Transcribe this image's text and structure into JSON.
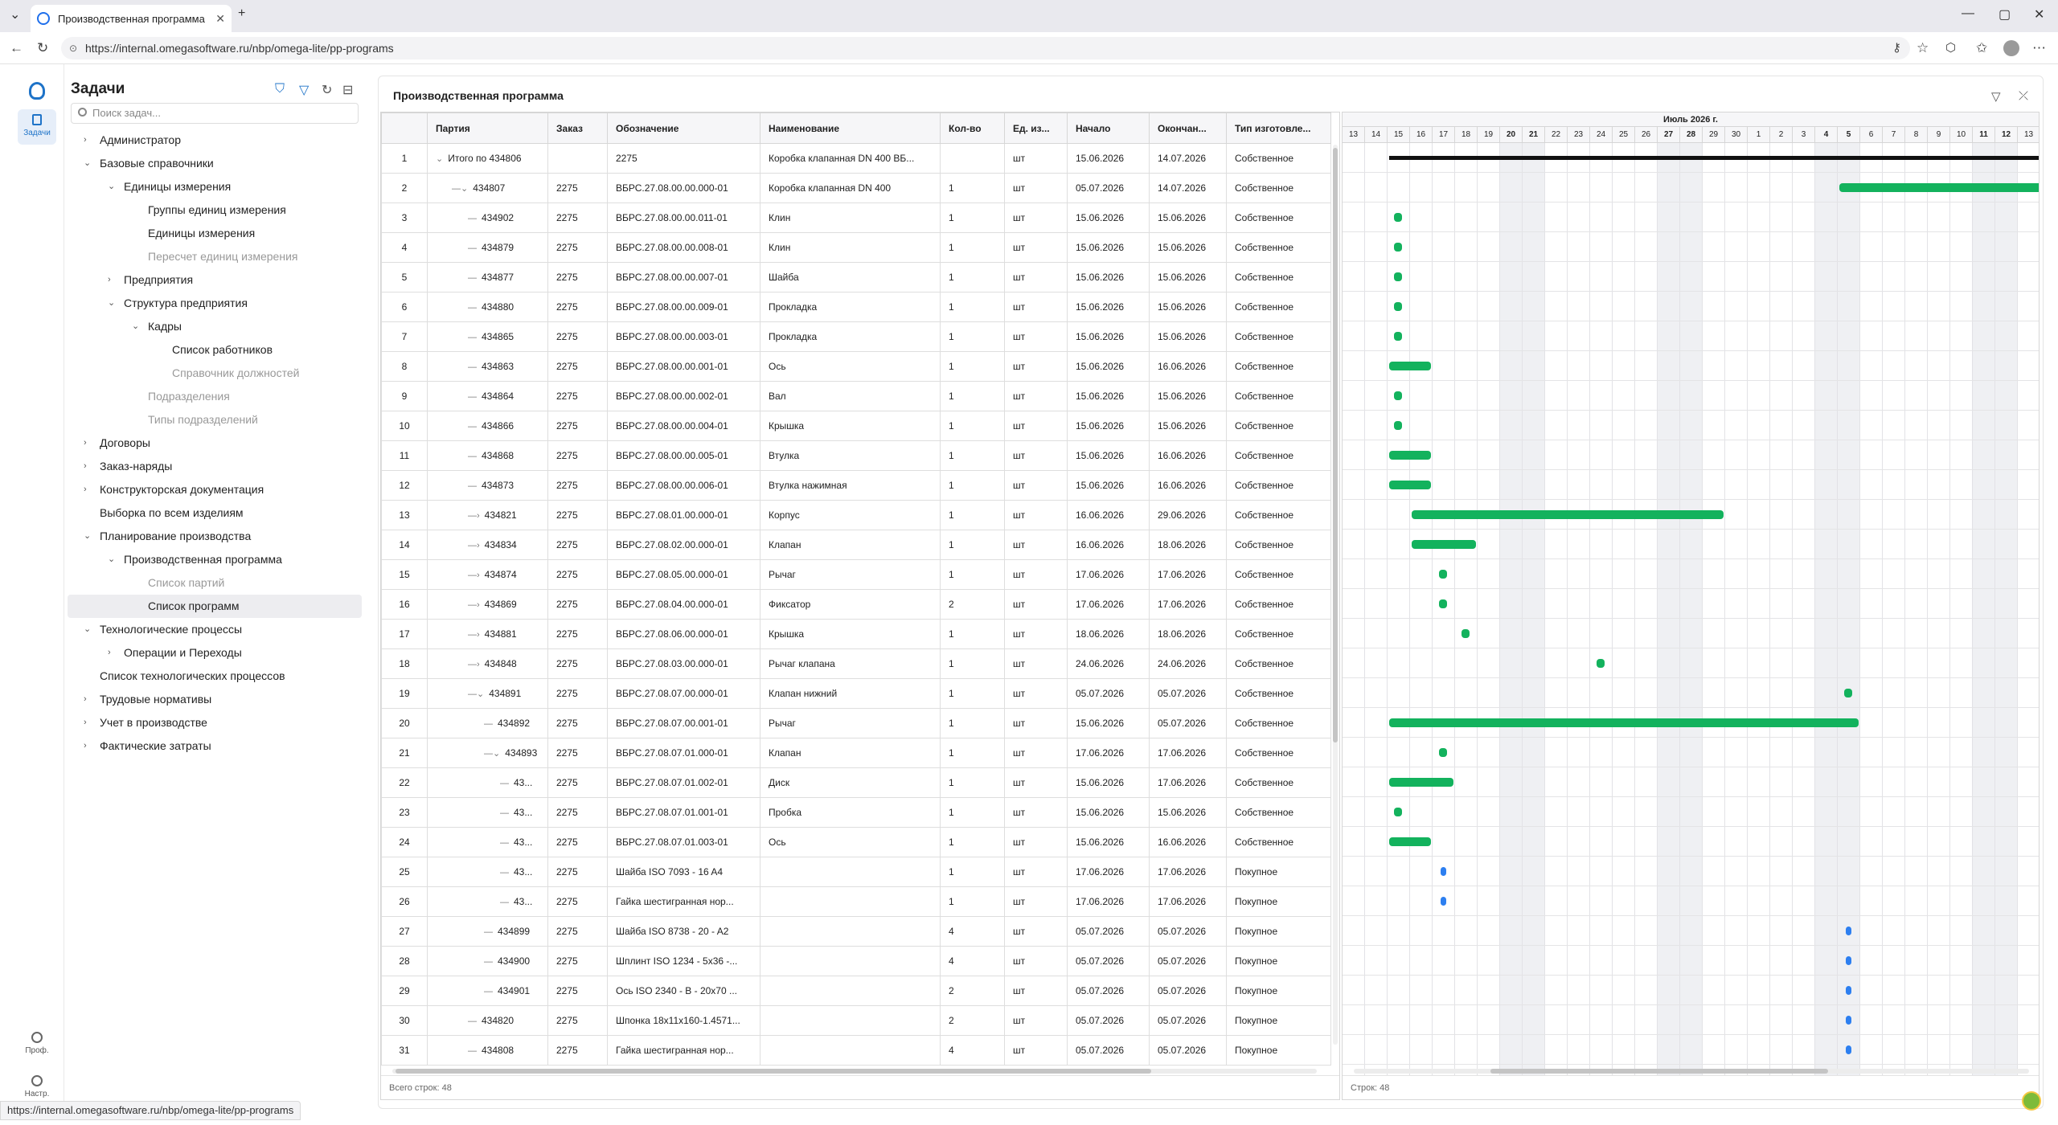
{
  "browser": {
    "tab_title": "Производственная программа",
    "url": "https://internal.omegasoftware.ru/nbp/omega-lite/pp-programs",
    "status_url": "https://internal.omegasoftware.ru/nbp/omega-lite/pp-programs"
  },
  "rail": {
    "tasks_label": "Задачи",
    "profile_label": "Проф.",
    "settings_label": "Настр."
  },
  "nav": {
    "title": "Задачи",
    "search_placeholder": "Поиск задач...",
    "items": [
      {
        "label": "Администратор",
        "level": 0,
        "chev": "›",
        "state": ""
      },
      {
        "label": "Базовые справочники",
        "level": 0,
        "chev": "⌄",
        "state": ""
      },
      {
        "label": "Единицы измерения",
        "level": 1,
        "chev": "⌄",
        "state": ""
      },
      {
        "label": "Группы единиц измерения",
        "level": 2,
        "chev": "",
        "state": ""
      },
      {
        "label": "Единицы измерения",
        "level": 2,
        "chev": "",
        "state": ""
      },
      {
        "label": "Пересчет единиц измерения",
        "level": 2,
        "chev": "",
        "state": "dis"
      },
      {
        "label": "Предприятия",
        "level": 1,
        "chev": "›",
        "state": ""
      },
      {
        "label": "Структура предприятия",
        "level": 1,
        "chev": "⌄",
        "state": ""
      },
      {
        "label": "Кадры",
        "level": 2,
        "chev": "⌄",
        "state": ""
      },
      {
        "label": "Список работников",
        "level": 3,
        "chev": "",
        "state": ""
      },
      {
        "label": "Справочник должностей",
        "level": 3,
        "chev": "",
        "state": "dis"
      },
      {
        "label": "Подразделения",
        "level": 2,
        "chev": "",
        "state": "dis"
      },
      {
        "label": "Типы подразделений",
        "level": 2,
        "chev": "",
        "state": "dis"
      },
      {
        "label": "Договоры",
        "level": 0,
        "chev": "›",
        "state": ""
      },
      {
        "label": "Заказ-наряды",
        "level": 0,
        "chev": "›",
        "state": ""
      },
      {
        "label": "Конструкторская документация",
        "level": 0,
        "chev": "›",
        "state": ""
      },
      {
        "label": "Выборка по всем изделиям",
        "level": 1,
        "chev": "",
        "state": "",
        "flat": true
      },
      {
        "label": "Планирование производства",
        "level": 0,
        "chev": "⌄",
        "state": ""
      },
      {
        "label": "Производственная программа",
        "level": 1,
        "chev": "⌄",
        "state": ""
      },
      {
        "label": "Список партий",
        "level": 2,
        "chev": "",
        "state": "dis"
      },
      {
        "label": "Список программ",
        "level": 2,
        "chev": "",
        "state": "sel"
      },
      {
        "label": "Технологические процессы",
        "level": 0,
        "chev": "⌄",
        "state": ""
      },
      {
        "label": "Операции и Переходы",
        "level": 1,
        "chev": "›",
        "state": ""
      },
      {
        "label": "Список технологических процессов",
        "level": 1,
        "chev": "",
        "state": "",
        "flat": true
      },
      {
        "label": "Трудовые нормативы",
        "level": 0,
        "chev": "›",
        "state": ""
      },
      {
        "label": "Учет в производстве",
        "level": 0,
        "chev": "›",
        "state": ""
      },
      {
        "label": "Фактические затраты",
        "level": 0,
        "chev": "›",
        "state": ""
      }
    ]
  },
  "main": {
    "title": "Производственная программа",
    "columns": [
      "",
      "Партия",
      "Заказ",
      "Обозначение",
      "Наименование",
      "Кол-во",
      "Ед. из...",
      "Начало",
      "Окончан...",
      "Тип изготовле..."
    ],
    "rows": [
      {
        "n": "1",
        "part": "Итого по 434806",
        "depth": 0,
        "exp": "⌄",
        "order": "",
        "code": "2275",
        "name": "Коробка клапанная DN 400 ВБ...",
        "qty": "",
        "unit": "шт",
        "start": "15.06.2026",
        "end": "14.07.2026",
        "type": "Собственное"
      },
      {
        "n": "2",
        "part": "434807",
        "depth": 1,
        "exp": "⌄",
        "order": "2275",
        "code": "ВБРС.27.08.00.00.000-01",
        "name": "Коробка клапанная DN 400",
        "qty": "1",
        "unit": "шт",
        "start": "05.07.2026",
        "end": "14.07.2026",
        "type": "Собственное"
      },
      {
        "n": "3",
        "part": "434902",
        "depth": 2,
        "exp": "",
        "order": "2275",
        "code": "ВБРС.27.08.00.00.011-01",
        "name": "Клин",
        "qty": "1",
        "unit": "шт",
        "start": "15.06.2026",
        "end": "15.06.2026",
        "type": "Собственное"
      },
      {
        "n": "4",
        "part": "434879",
        "depth": 2,
        "exp": "",
        "order": "2275",
        "code": "ВБРС.27.08.00.00.008-01",
        "name": "Клин",
        "qty": "1",
        "unit": "шт",
        "start": "15.06.2026",
        "end": "15.06.2026",
        "type": "Собственное"
      },
      {
        "n": "5",
        "part": "434877",
        "depth": 2,
        "exp": "",
        "order": "2275",
        "code": "ВБРС.27.08.00.00.007-01",
        "name": "Шайба",
        "qty": "1",
        "unit": "шт",
        "start": "15.06.2026",
        "end": "15.06.2026",
        "type": "Собственное"
      },
      {
        "n": "6",
        "part": "434880",
        "depth": 2,
        "exp": "",
        "order": "2275",
        "code": "ВБРС.27.08.00.00.009-01",
        "name": "Прокладка",
        "qty": "1",
        "unit": "шт",
        "start": "15.06.2026",
        "end": "15.06.2026",
        "type": "Собственное"
      },
      {
        "n": "7",
        "part": "434865",
        "depth": 2,
        "exp": "",
        "order": "2275",
        "code": "ВБРС.27.08.00.00.003-01",
        "name": "Прокладка",
        "qty": "1",
        "unit": "шт",
        "start": "15.06.2026",
        "end": "15.06.2026",
        "type": "Собственное"
      },
      {
        "n": "8",
        "part": "434863",
        "depth": 2,
        "exp": "",
        "order": "2275",
        "code": "ВБРС.27.08.00.00.001-01",
        "name": "Ось",
        "qty": "1",
        "unit": "шт",
        "start": "15.06.2026",
        "end": "16.06.2026",
        "type": "Собственное"
      },
      {
        "n": "9",
        "part": "434864",
        "depth": 2,
        "exp": "",
        "order": "2275",
        "code": "ВБРС.27.08.00.00.002-01",
        "name": "Вал",
        "qty": "1",
        "unit": "шт",
        "start": "15.06.2026",
        "end": "15.06.2026",
        "type": "Собственное"
      },
      {
        "n": "10",
        "part": "434866",
        "depth": 2,
        "exp": "",
        "order": "2275",
        "code": "ВБРС.27.08.00.00.004-01",
        "name": "Крышка",
        "qty": "1",
        "unit": "шт",
        "start": "15.06.2026",
        "end": "15.06.2026",
        "type": "Собственное"
      },
      {
        "n": "11",
        "part": "434868",
        "depth": 2,
        "exp": "",
        "order": "2275",
        "code": "ВБРС.27.08.00.00.005-01",
        "name": "Втулка",
        "qty": "1",
        "unit": "шт",
        "start": "15.06.2026",
        "end": "16.06.2026",
        "type": "Собственное"
      },
      {
        "n": "12",
        "part": "434873",
        "depth": 2,
        "exp": "",
        "order": "2275",
        "code": "ВБРС.27.08.00.00.006-01",
        "name": "Втулка нажимная",
        "qty": "1",
        "unit": "шт",
        "start": "15.06.2026",
        "end": "16.06.2026",
        "type": "Собственное"
      },
      {
        "n": "13",
        "part": "434821",
        "depth": 2,
        "exp": "›",
        "order": "2275",
        "code": "ВБРС.27.08.01.00.000-01",
        "name": "Корпус",
        "qty": "1",
        "unit": "шт",
        "start": "16.06.2026",
        "end": "29.06.2026",
        "type": "Собственное"
      },
      {
        "n": "14",
        "part": "434834",
        "depth": 2,
        "exp": "›",
        "order": "2275",
        "code": "ВБРС.27.08.02.00.000-01",
        "name": "Клапан",
        "qty": "1",
        "unit": "шт",
        "start": "16.06.2026",
        "end": "18.06.2026",
        "type": "Собственное"
      },
      {
        "n": "15",
        "part": "434874",
        "depth": 2,
        "exp": "›",
        "order": "2275",
        "code": "ВБРС.27.08.05.00.000-01",
        "name": "Рычаг",
        "qty": "1",
        "unit": "шт",
        "start": "17.06.2026",
        "end": "17.06.2026",
        "type": "Собственное"
      },
      {
        "n": "16",
        "part": "434869",
        "depth": 2,
        "exp": "›",
        "order": "2275",
        "code": "ВБРС.27.08.04.00.000-01",
        "name": "Фиксатор",
        "qty": "2",
        "unit": "шт",
        "start": "17.06.2026",
        "end": "17.06.2026",
        "type": "Собственное"
      },
      {
        "n": "17",
        "part": "434881",
        "depth": 2,
        "exp": "›",
        "order": "2275",
        "code": "ВБРС.27.08.06.00.000-01",
        "name": "Крышка",
        "qty": "1",
        "unit": "шт",
        "start": "18.06.2026",
        "end": "18.06.2026",
        "type": "Собственное"
      },
      {
        "n": "18",
        "part": "434848",
        "depth": 2,
        "exp": "›",
        "order": "2275",
        "code": "ВБРС.27.08.03.00.000-01",
        "name": "Рычаг клапана",
        "qty": "1",
        "unit": "шт",
        "start": "24.06.2026",
        "end": "24.06.2026",
        "type": "Собственное"
      },
      {
        "n": "19",
        "part": "434891",
        "depth": 2,
        "exp": "⌄",
        "order": "2275",
        "code": "ВБРС.27.08.07.00.000-01",
        "name": "Клапан нижний",
        "qty": "1",
        "unit": "шт",
        "start": "05.07.2026",
        "end": "05.07.2026",
        "type": "Собственное"
      },
      {
        "n": "20",
        "part": "434892",
        "depth": 3,
        "exp": "",
        "order": "2275",
        "code": "ВБРС.27.08.07.00.001-01",
        "name": "Рычаг",
        "qty": "1",
        "unit": "шт",
        "start": "15.06.2026",
        "end": "05.07.2026",
        "type": "Собственное"
      },
      {
        "n": "21",
        "part": "434893",
        "depth": 3,
        "exp": "⌄",
        "order": "2275",
        "code": "ВБРС.27.08.07.01.000-01",
        "name": "Клапан",
        "qty": "1",
        "unit": "шт",
        "start": "17.06.2026",
        "end": "17.06.2026",
        "type": "Собственное"
      },
      {
        "n": "22",
        "part": "43...",
        "depth": 4,
        "exp": "",
        "order": "2275",
        "code": "ВБРС.27.08.07.01.002-01",
        "name": "Диск",
        "qty": "1",
        "unit": "шт",
        "start": "15.06.2026",
        "end": "17.06.2026",
        "type": "Собственное"
      },
      {
        "n": "23",
        "part": "43...",
        "depth": 4,
        "exp": "",
        "order": "2275",
        "code": "ВБРС.27.08.07.01.001-01",
        "name": "Пробка",
        "qty": "1",
        "unit": "шт",
        "start": "15.06.2026",
        "end": "15.06.2026",
        "type": "Собственное"
      },
      {
        "n": "24",
        "part": "43...",
        "depth": 4,
        "exp": "",
        "order": "2275",
        "code": "ВБРС.27.08.07.01.003-01",
        "name": "Ось",
        "qty": "1",
        "unit": "шт",
        "start": "15.06.2026",
        "end": "16.06.2026",
        "type": "Собственное"
      },
      {
        "n": "25",
        "part": "43...",
        "depth": 4,
        "exp": "",
        "order": "2275",
        "code": "Шайба ISO 7093 - 16 A4",
        "name": "",
        "qty": "1",
        "unit": "шт",
        "start": "17.06.2026",
        "end": "17.06.2026",
        "type": "Покупное"
      },
      {
        "n": "26",
        "part": "43...",
        "depth": 4,
        "exp": "",
        "order": "2275",
        "code": "Гайка шестигранная нор...",
        "name": "",
        "qty": "1",
        "unit": "шт",
        "start": "17.06.2026",
        "end": "17.06.2026",
        "type": "Покупное"
      },
      {
        "n": "27",
        "part": "434899",
        "depth": 3,
        "exp": "",
        "order": "2275",
        "code": "Шайба ISO 8738 - 20 - A2",
        "name": "",
        "qty": "4",
        "unit": "шт",
        "start": "05.07.2026",
        "end": "05.07.2026",
        "type": "Покупное"
      },
      {
        "n": "28",
        "part": "434900",
        "depth": 3,
        "exp": "",
        "order": "2275",
        "code": "Шплинт ISO 1234 - 5x36 -...",
        "name": "",
        "qty": "4",
        "unit": "шт",
        "start": "05.07.2026",
        "end": "05.07.2026",
        "type": "Покупное"
      },
      {
        "n": "29",
        "part": "434901",
        "depth": 3,
        "exp": "",
        "order": "2275",
        "code": "Ось ISO 2340 - B - 20x70 ...",
        "name": "",
        "qty": "2",
        "unit": "шт",
        "start": "05.07.2026",
        "end": "05.07.2026",
        "type": "Покупное"
      },
      {
        "n": "30",
        "part": "434820",
        "depth": 2,
        "exp": "",
        "order": "2275",
        "code": "Шпонка 18x11x160-1.4571...",
        "name": "",
        "qty": "2",
        "unit": "шт",
        "start": "05.07.2026",
        "end": "05.07.2026",
        "type": "Покупное"
      },
      {
        "n": "31",
        "part": "434808",
        "depth": 2,
        "exp": "",
        "order": "2275",
        "code": "Гайка шестигранная нор...",
        "name": "",
        "qty": "4",
        "unit": "шт",
        "start": "05.07.2026",
        "end": "05.07.2026",
        "type": "Покупное"
      }
    ],
    "footer": "Всего строк: 48"
  },
  "gantt": {
    "month_label": "Июль 2026 г.",
    "days": [
      "13",
      "14",
      "15",
      "16",
      "17",
      "18",
      "19",
      "20",
      "21",
      "22",
      "23",
      "24",
      "25",
      "26",
      "27",
      "28",
      "29",
      "30",
      "1",
      "2",
      "3",
      "4",
      "5",
      "6",
      "7",
      "8",
      "9",
      "10",
      "11",
      "12",
      "13"
    ],
    "weekend_days": [
      7,
      8,
      14,
      15,
      21,
      22,
      28,
      29
    ],
    "footer": "Строк: 48",
    "colors": {
      "own": "#13b25d",
      "purchased": "#2d7ff0",
      "summary": "#111111"
    }
  }
}
